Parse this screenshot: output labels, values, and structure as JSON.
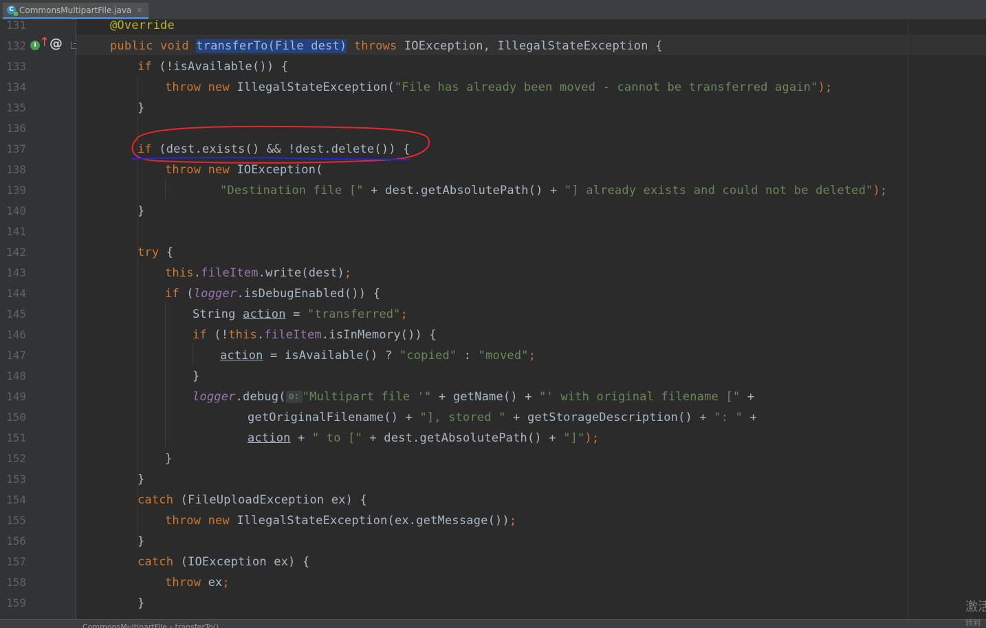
{
  "tab": {
    "filename": "CommonsMultipartFile.java",
    "icon_letter": "C",
    "close": "×"
  },
  "gutter_icons": {
    "implements": "I",
    "override_arrow": "↑",
    "annotation": "@"
  },
  "line_numbers": [
    "131",
    "132",
    "133",
    "134",
    "135",
    "136",
    "137",
    "138",
    "139",
    "140",
    "141",
    "142",
    "143",
    "144",
    "145",
    "146",
    "147",
    "148",
    "149",
    "150",
    "151",
    "152",
    "153",
    "154",
    "155",
    "156",
    "157",
    "158",
    "159"
  ],
  "code": {
    "l131": {
      "annotation": "@Override"
    },
    "l132": {
      "public": "public",
      "void": "void",
      "sig": "transferTo(File dest)",
      "throws": "throws",
      "rest": " IOException, IllegalStateException {"
    },
    "l133": {
      "if": "if",
      "rest": " (!isAvailable()) {"
    },
    "l134": {
      "throw": "throw",
      "new": "new",
      "cls": " IllegalStateException(",
      "msg": "\"File has already been moved - cannot be transferred again\"",
      "end": ");"
    },
    "l135": {
      "brace": "}"
    },
    "l137": {
      "if": "if",
      "rest": " (dest.exists() && !dest.delete()) {"
    },
    "l138": {
      "throw": "throw",
      "new": "new",
      "rest": " IOException("
    },
    "l139": {
      "s1": "\"Destination file [\"",
      "mid": " + dest.getAbsolutePath() + ",
      "s2": "\"] already exists and could not be deleted\"",
      "end": ");"
    },
    "l140": {
      "brace": "}"
    },
    "l142": {
      "try": "try",
      "rest": " {"
    },
    "l143": {
      "this": "this",
      "dot": ".",
      "field": "fileItem",
      "rest": ".write(dest)",
      "semi": ";"
    },
    "l144": {
      "if": "if",
      "p1": " (",
      "logger": "logger",
      "rest": ".isDebugEnabled()) {"
    },
    "l145": {
      "type": "String ",
      "var": "action",
      "eq": " = ",
      "str": "\"transferred\"",
      "semi": ";"
    },
    "l146": {
      "if": "if",
      "p1": " (!",
      "this": "this",
      "dot": ".",
      "field": "fileItem",
      "rest": ".isInMemory()) {"
    },
    "l147": {
      "var": "action",
      "mid": " = isAvailable() ? ",
      "s1": "\"copied\"",
      "colon": " : ",
      "s2": "\"moved\"",
      "semi": ";"
    },
    "l148": {
      "brace": "}"
    },
    "l149": {
      "logger": "logger",
      "call": ".debug(",
      "hint": "o:",
      "s1": "\"Multipart file '\"",
      "m1": " + getName() + ",
      "s2": "\"' with original filename [\"",
      "m2": " +"
    },
    "l150": {
      "m1": "getOriginalFilename() + ",
      "s1": "\"], stored \"",
      "m2": " + getStorageDescription() + ",
      "s2": "\": \"",
      "m3": " +"
    },
    "l151": {
      "var": "action",
      "m1": " + ",
      "s1": "\" to [\"",
      "m2": " + dest.getAbsolutePath() + ",
      "s2": "\"]\"",
      "end": ");"
    },
    "l152": {
      "brace": "}"
    },
    "l153": {
      "brace": "}"
    },
    "l154": {
      "catch": "catch",
      "rest": " (FileUploadException ex) {"
    },
    "l155": {
      "throw": "throw",
      "new": "new",
      "rest": " IllegalStateException(ex.getMessage())",
      "semi": ";"
    },
    "l156": {
      "brace": "}"
    },
    "l157": {
      "catch": "catch",
      "rest": " (IOException ex) {"
    },
    "l158": {
      "throw": "throw",
      "rest": " ex",
      "semi": ";"
    },
    "l159": {
      "brace": "}"
    }
  },
  "status_bar": {
    "breadcrumb": "CommonsMultipartFile › transferTo()"
  },
  "watermark": {
    "line1": "激活",
    "line2": "转到"
  },
  "colors": {
    "background": "#2b2b2b",
    "keyword": "#cc7832",
    "string": "#6a8759",
    "annotation": "#bbb529",
    "field": "#9876aa",
    "default_text": "#a9b7c6",
    "selection": "#214283",
    "red_marker": "#e8272a",
    "blue_underline": "#1f2bd6"
  }
}
